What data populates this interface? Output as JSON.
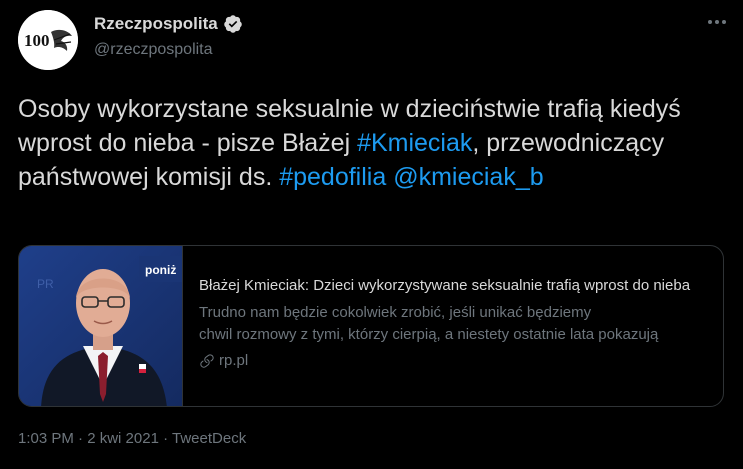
{
  "author": {
    "display_name": "Rzeczpospolita",
    "handle": "@rzeczpospolita",
    "avatar_text": "100",
    "verified": true
  },
  "tweet": {
    "parts": [
      "Osoby wykorzystane seksualnie w dzieciństwie trafią kiedyś wprost do nieba - pisze Błażej ",
      "#Kmieciak",
      ", przewodniczący państwowej komisji ds. ",
      "#pedofilia",
      " ",
      "@kmieciak_b"
    ]
  },
  "card": {
    "title": "Błażej Kmieciak: Dzieci wykorzystywane seksualnie trafią wprost do nieba",
    "desc_line1": "Trudno nam będzie cokolwiek zrobić, jeśli unikać będziemy",
    "desc_line2": "chwil rozmowy z tymi, którzy cierpią, a niestety ostatnie lata pokazują",
    "domain": "rp.pl",
    "thumb_overlay": "poniż",
    "thumb_bg_text": "PR"
  },
  "meta": {
    "time": "1:03 PM",
    "date": "2 kwi 2021",
    "separator": " · ",
    "source": "TweetDeck"
  },
  "colors": {
    "background": "#000000",
    "text": "#d9d9d9",
    "secondary": "#6e767d",
    "link": "#1d9bf0",
    "border": "#2f3336"
  }
}
